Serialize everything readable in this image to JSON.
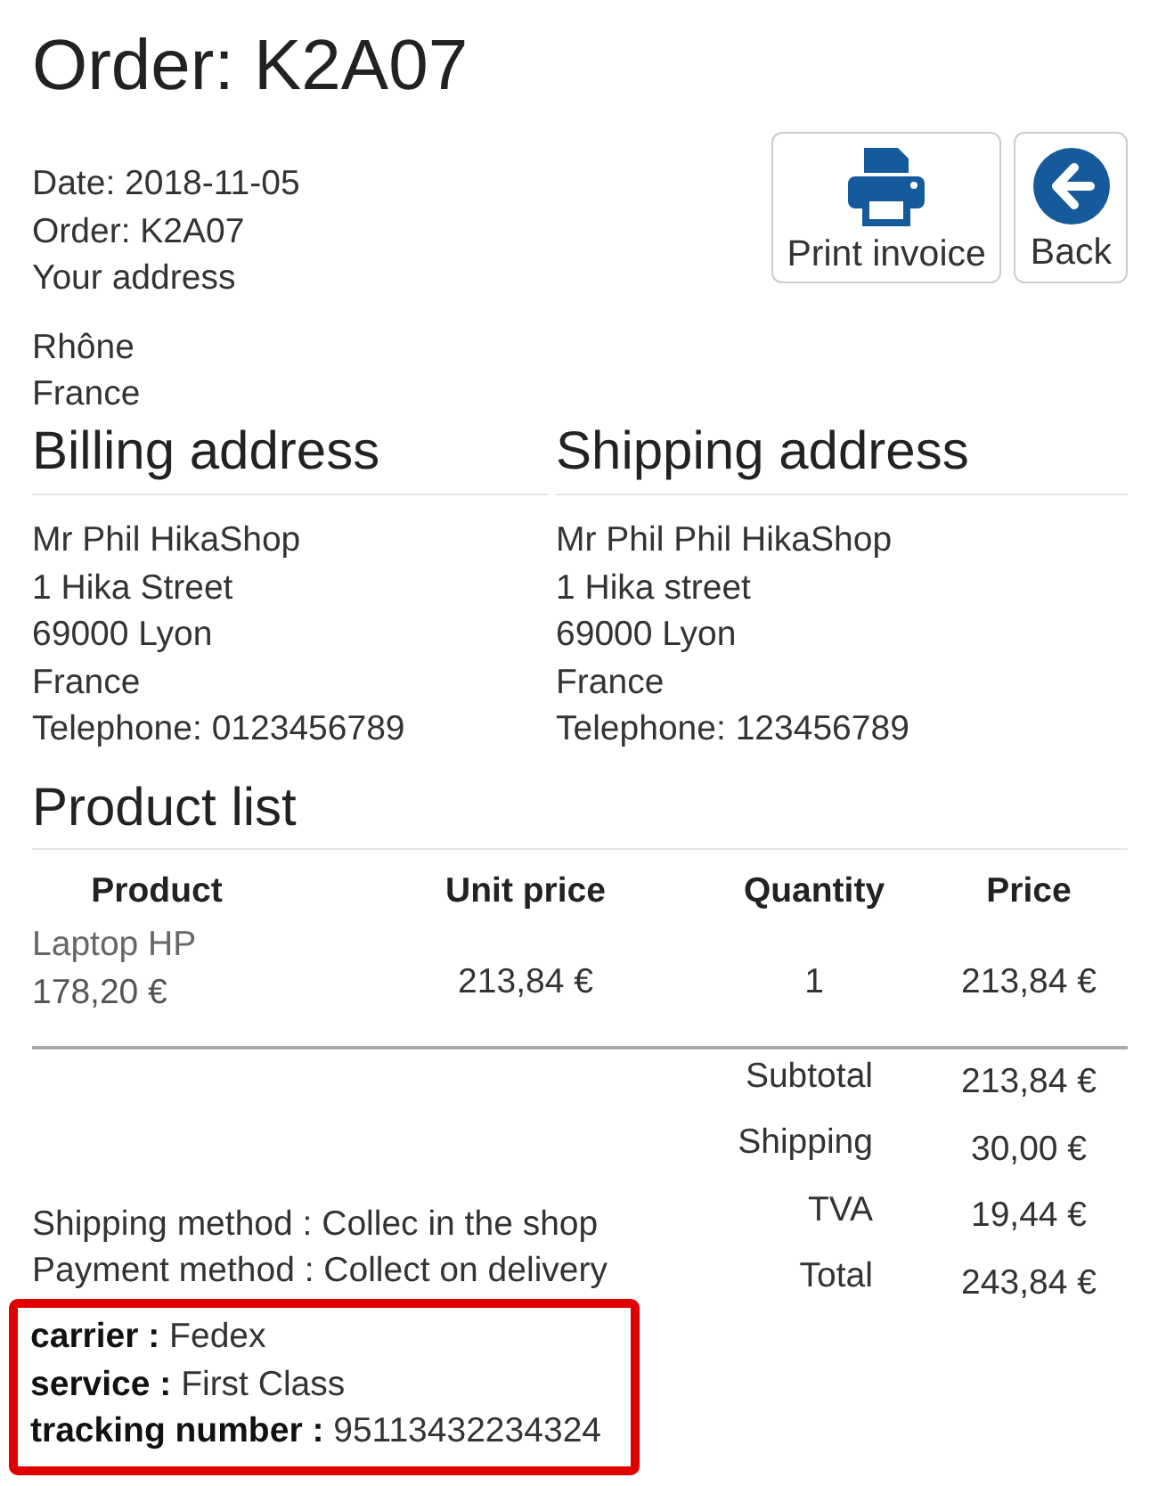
{
  "page": {
    "title": "Order: K2A07"
  },
  "actions": [
    {
      "kind": "print",
      "label": "Print invoice"
    },
    {
      "kind": "back",
      "label": "Back"
    }
  ],
  "order_info": [
    "Date: 2018-11-05",
    "Order: K2A07",
    "Your address"
  ],
  "your_address": [
    "Rhône",
    "France"
  ],
  "addresses": [
    {
      "heading": "Billing address",
      "lines": [
        "Mr Phil HikaShop",
        "1 Hika Street",
        "69000 Lyon",
        "France",
        "Telephone: 0123456789"
      ]
    },
    {
      "heading": "Shipping address",
      "lines": [
        "Mr Phil Phil HikaShop",
        "1 Hika street",
        "69000 Lyon",
        "France",
        "Telephone: 123456789"
      ]
    }
  ],
  "product_list": {
    "heading": "Product list",
    "columns": [
      "Product",
      "Unit price",
      "Quantity",
      "Price"
    ],
    "rows": [
      {
        "product": "Laptop HP",
        "product_price": "178,20 €",
        "unit_price": "213,84 €",
        "quantity": "1",
        "price": "213,84 €"
      }
    ]
  },
  "totals": [
    {
      "label": "Subtotal",
      "value": "213,84 €"
    },
    {
      "label": "Shipping",
      "value": "30,00 €"
    },
    {
      "label": "TVA",
      "value": "19,44 €"
    },
    {
      "label": "Total",
      "value": "243,84 €"
    }
  ],
  "methods": [
    "Shipping method : Collec in the shop",
    "Payment method : Collect on delivery"
  ],
  "tracking": {
    "highlighted": true,
    "lines": [
      "**carrier :** Fedex",
      "**service :** First Class",
      "**tracking number :** 95113432234324"
    ]
  }
}
